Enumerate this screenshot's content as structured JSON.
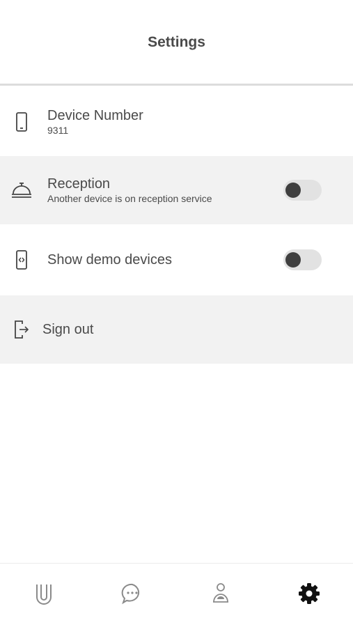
{
  "header": {
    "title": "Settings"
  },
  "settings": {
    "device": {
      "title": "Device Number",
      "value": "9311",
      "icon": "phone-icon"
    },
    "reception": {
      "title": "Reception",
      "subtitle": "Another device is on reception service",
      "icon": "reception-bell-icon",
      "enabled": false
    },
    "demo": {
      "title": "Show demo devices",
      "icon": "code-device-icon",
      "enabled": false
    },
    "signout": {
      "title": "Sign out",
      "icon": "sign-out-icon"
    }
  },
  "tabbar": {
    "tabs": [
      {
        "icon": "u-logo-icon",
        "active": false
      },
      {
        "icon": "chat-icon",
        "active": false
      },
      {
        "icon": "person-icon",
        "active": false
      },
      {
        "icon": "gear-icon",
        "active": true
      }
    ]
  },
  "colors": {
    "row_alt_bg": "#f2f2f2",
    "toggle_track": "#e2e2e2",
    "toggle_knob": "#3f3f3f",
    "active_tab": "#111111",
    "inactive_tab": "#8a8a8a"
  }
}
